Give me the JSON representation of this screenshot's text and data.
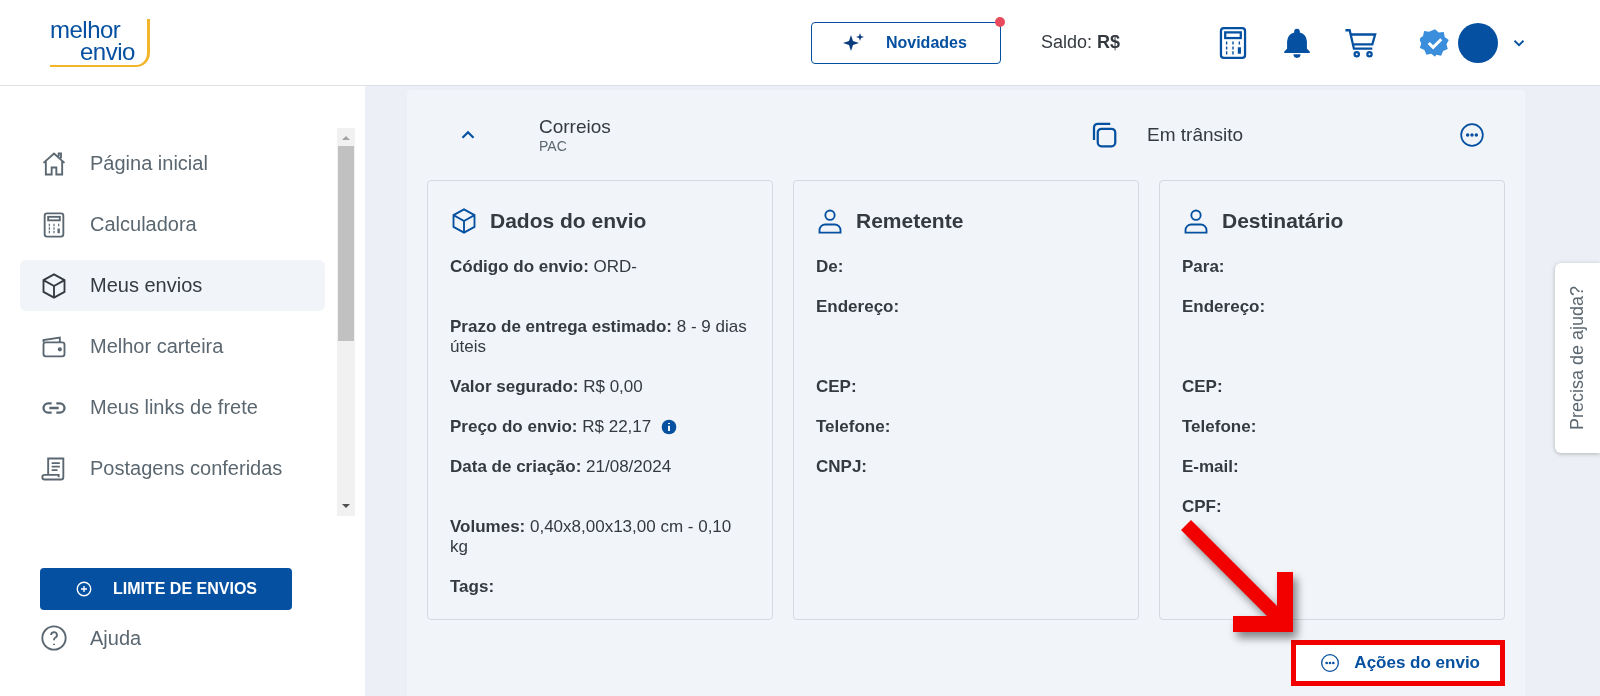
{
  "header": {
    "logo": {
      "line_1": "melhor",
      "line_2": "envio"
    },
    "news_button": {
      "label": "Novidades",
      "unread": true
    },
    "balance": {
      "label": "Saldo:",
      "value": "R$"
    }
  },
  "sidebar": {
    "items": [
      {
        "label": "Página inicial",
        "selected": false
      },
      {
        "label": "Calculadora",
        "selected": false
      },
      {
        "label": "Meus envios",
        "selected": true
      },
      {
        "label": "Melhor carteira",
        "selected": false
      },
      {
        "label": "Meus links de frete",
        "selected": false
      },
      {
        "label": "Postagens conferidas",
        "selected": false
      }
    ],
    "limit_button": "LIMITE DE ENVIOS",
    "help_link": "Ajuda"
  },
  "shipment": {
    "expanded": true,
    "carrier": "Correios",
    "service": "PAC",
    "status": "Em trânsito",
    "sections": [
      {
        "title": "Dados do envio",
        "rows": [
          {
            "label": "Código do envio:",
            "value": "ORD-",
            "kind": "redacted"
          },
          {
            "label": "Prazo de entrega estimado:",
            "value": "8 - 9 dias úteis",
            "kind": "text"
          },
          {
            "label": "Valor segurado:",
            "value": "R$ 0,00",
            "kind": "text"
          },
          {
            "label": "Preço do envio:",
            "value": "R$ 22,17",
            "kind": "info"
          },
          {
            "label": "Data de criação:",
            "value": "21/08/2024",
            "kind": "redacted"
          },
          {
            "label": "Volumes:",
            "value": "0,40x8,00x13,00 cm - 0,10 kg",
            "kind": "text"
          },
          {
            "label": "Tags:",
            "kind": "text"
          }
        ]
      },
      {
        "title": "Remetente",
        "rows": [
          {
            "label": "De:",
            "kind": "text"
          },
          {
            "label": "Endereço:",
            "kind": "address"
          },
          {
            "label": "CEP:",
            "kind": "text"
          },
          {
            "label": "Telefone:",
            "kind": "text"
          },
          {
            "label": "CNPJ:",
            "kind": "text"
          }
        ]
      },
      {
        "title": "Destinatário",
        "rows": [
          {
            "label": "Para:",
            "kind": "text"
          },
          {
            "label": "Endereço:",
            "kind": "address"
          },
          {
            "label": "CEP:",
            "kind": "text"
          },
          {
            "label": "Telefone:",
            "kind": "text"
          },
          {
            "label": "E-mail:",
            "kind": "text"
          },
          {
            "label": "CPF:",
            "kind": "text"
          }
        ]
      }
    ],
    "actions_button": {
      "label": "Ações do envio",
      "highlighted": true
    }
  },
  "help_tab": "Precisa de ajuda?"
}
